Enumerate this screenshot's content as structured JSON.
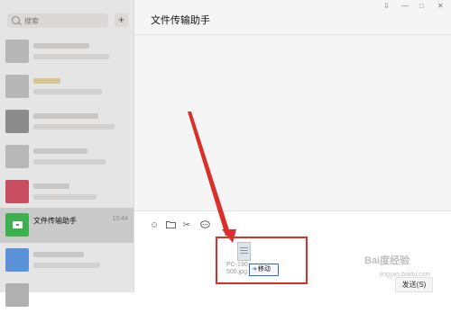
{
  "sidebar": {
    "search_placeholder": "搜索",
    "add_label": "+",
    "items": [
      {
        "name": "",
        "time": "",
        "avatar_color": "#b8b7b7"
      },
      {
        "name": "",
        "time": "",
        "avatar_color": "#c2a35a"
      },
      {
        "name": "",
        "time": "",
        "avatar_color": "#8c8c8c"
      },
      {
        "name": "",
        "time": "",
        "avatar_color": "#b8b8b8"
      },
      {
        "name": "",
        "time": "",
        "avatar_color": "#c74d60"
      },
      {
        "name": "文件传输助手",
        "time": "10:44",
        "avatar_color": "#3db04e",
        "active": true
      },
      {
        "name": "",
        "time": "",
        "avatar_color": "#5b93d8"
      }
    ]
  },
  "main": {
    "title": "文件传输助手",
    "window_controls": [
      "⇩",
      "—",
      "□",
      "✕"
    ],
    "composer": {
      "tools": [
        "emoji-icon",
        "folder-icon",
        "scissors-icon",
        "chat-bubble-icon"
      ],
      "send_label": "发送(S)"
    },
    "drag": {
      "file_name": "PC-190\n500.jpg",
      "move_label": "移动"
    }
  },
  "watermark": {
    "text": "Bai度经验",
    "sub": "jingyan.baidu.com"
  },
  "colors": {
    "annotation": "#d9302a",
    "accent_green": "#3db04e",
    "move_border": "#2c69d4"
  }
}
